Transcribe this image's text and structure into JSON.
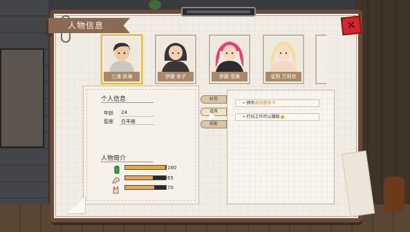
{
  "window": {
    "title": "人物信息",
    "close_label": "✕"
  },
  "characters": [
    {
      "name": "三浦 凯海",
      "selected": true
    },
    {
      "name": "伊藤 幸子",
      "selected": false
    },
    {
      "name": "伊藤 雪美",
      "selected": false
    },
    {
      "name": "星野 万莉奈",
      "selected": false
    }
  ],
  "profile": {
    "section_title": "个人信息",
    "fields": [
      {
        "label": "年龄",
        "value": "24"
      },
      {
        "label": "星座",
        "value": "白羊座"
      }
    ]
  },
  "intro": {
    "section_title": "人物简介",
    "stats": [
      {
        "icon": "battery-icon",
        "value": 160,
        "fraction": 0.98
      },
      {
        "icon": "strength-arm-icon",
        "value": 65,
        "fraction": 0.67
      },
      {
        "icon": "rock-hand-icon",
        "value": 70,
        "fraction": 0.72
      }
    ]
  },
  "tabs": [
    {
      "label": "标签",
      "active": false
    },
    {
      "label": "道具",
      "active": true
    },
    {
      "label": "技能",
      "active": false
    }
  ],
  "list": {
    "items": [
      {
        "prefix": "• 拥有",
        "highlight": "高级健身卡",
        "suffix": ""
      },
      {
        "prefix": "• 打扫工作可以赚取",
        "highlight": "",
        "suffix": "",
        "coin": true
      }
    ]
  },
  "colors": {
    "frame": "#6b4a3a",
    "paper": "#f2ede4",
    "banner": "#8a6a52",
    "close": "#d8242a",
    "bar_fill": "#e3a847",
    "nameplate": "#a88a6a"
  }
}
